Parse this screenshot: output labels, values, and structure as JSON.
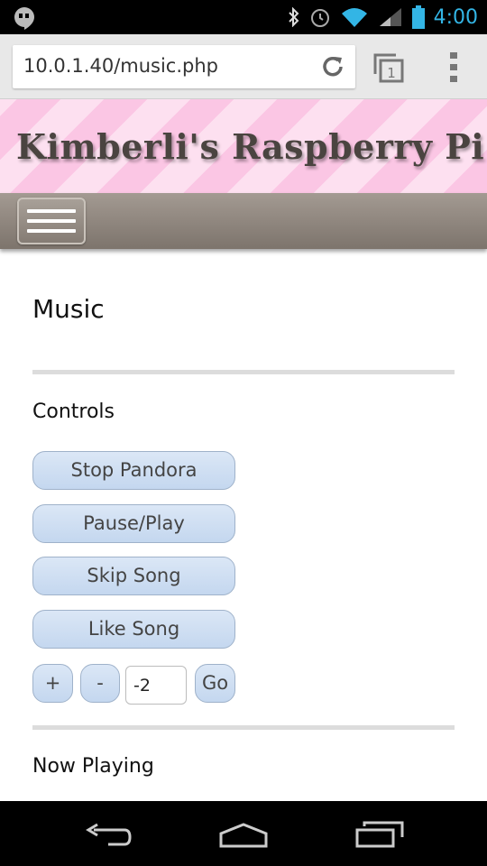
{
  "status_bar": {
    "time": "4:00",
    "icons": [
      "hangouts-icon",
      "bluetooth-icon",
      "alarm-icon",
      "wifi-icon",
      "signal-icon",
      "battery-icon"
    ]
  },
  "browser": {
    "url": "10.0.1.40/music.php",
    "tab_count": "1"
  },
  "site": {
    "title": "Kimberli's Raspberry Pi"
  },
  "page": {
    "title": "Music",
    "controls_heading": "Controls",
    "buttons": {
      "stop": "Stop Pandora",
      "pause": "Pause/Play",
      "skip": "Skip Song",
      "like": "Like Song",
      "plus": "+",
      "minus": "-",
      "go": "Go"
    },
    "volume_value": "-2",
    "now_playing_heading": "Now Playing"
  },
  "colors": {
    "accent": "#33b5e5",
    "button_fill": "#c4d7ef",
    "header_pink": "#fbc6e4",
    "nav_brown": "#7d746c"
  }
}
